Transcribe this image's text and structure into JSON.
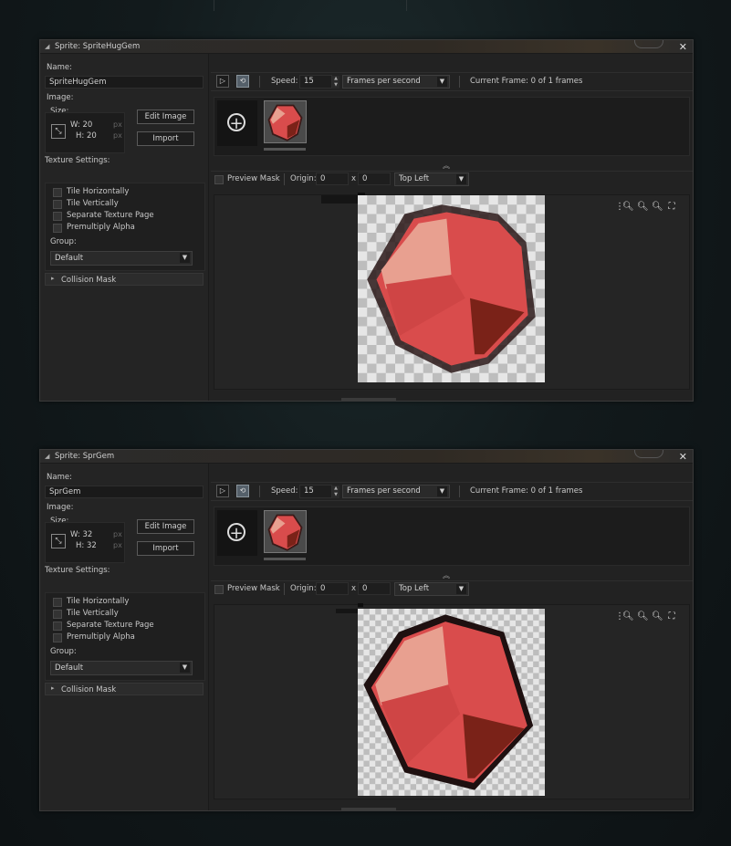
{
  "windows": [
    {
      "title": "Sprite: SpriteHugGem",
      "name_label": "Name:",
      "name_value": "SpriteHugGem",
      "image_label": "Image:",
      "size_label": "Size:",
      "width": "W: 20",
      "height": "H: 20",
      "px_unit": "px",
      "edit_image": "Edit Image",
      "import": "Import",
      "texture_label": "Texture Settings:",
      "texture_options": [
        {
          "label": "Tile Horizontally",
          "checked": false
        },
        {
          "label": "Tile Vertically",
          "checked": false
        },
        {
          "label": "Separate Texture Page",
          "checked": false
        },
        {
          "label": "Premultiply Alpha",
          "checked": false
        }
      ],
      "group_label": "Group:",
      "group_value": "Default",
      "collision_mask": "Collision Mask",
      "speed_label": "Speed:",
      "speed_value": "15",
      "speed_unit": "Frames per second",
      "current_frame": "Current Frame: 0 of 1 frames",
      "preview_mask": "Preview Mask",
      "origin_label": "Origin:",
      "origin_x": "0",
      "origin_x_sep": "x",
      "origin_y": "0",
      "origin_preset": "Top Left"
    },
    {
      "title": "Sprite: SprGem",
      "name_label": "Name:",
      "name_value": "SprGem",
      "image_label": "Image:",
      "size_label": "Size:",
      "width": "W: 32",
      "height": "H: 32",
      "px_unit": "px",
      "edit_image": "Edit Image",
      "import": "Import",
      "texture_label": "Texture Settings:",
      "texture_options": [
        {
          "label": "Tile Horizontally",
          "checked": false
        },
        {
          "label": "Tile Vertically",
          "checked": false
        },
        {
          "label": "Separate Texture Page",
          "checked": false
        },
        {
          "label": "Premultiply Alpha",
          "checked": false
        }
      ],
      "group_label": "Group:",
      "group_value": "Default",
      "collision_mask": "Collision Mask",
      "speed_label": "Speed:",
      "speed_value": "15",
      "speed_unit": "Frames per second",
      "current_frame": "Current Frame: 0 of 1 frames",
      "preview_mask": "Preview Mask",
      "origin_label": "Origin:",
      "origin_x": "0",
      "origin_x_sep": "x",
      "origin_y": "0",
      "origin_preset": "Top Left"
    }
  ],
  "icons": {
    "collapse": "collapse-triangle-icon",
    "close": "close-icon",
    "play": "play-icon",
    "loop": "loop-icon",
    "add_frame": "add-frame-icon",
    "zoom_out": "zoom-out-icon",
    "zoom_reset": "zoom-reset-icon",
    "zoom_in": "zoom-in-icon",
    "fullscreen": "fullscreen-icon"
  },
  "colors": {
    "gem_light": "#e8a090",
    "gem_mid": "#d94c4c",
    "gem_dark": "#7a2218",
    "toggle_active": "#55606a"
  }
}
